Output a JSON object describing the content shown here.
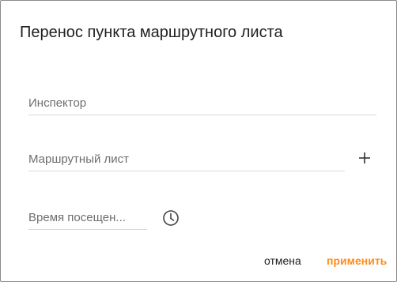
{
  "dialog": {
    "title": "Перенос пункта маршрутного листа",
    "fields": {
      "inspector_placeholder": "Инспектор",
      "route_sheet_placeholder": "Маршрутный лист",
      "visit_time_placeholder": "Время посещен..."
    },
    "icons": {
      "add": "plus-icon",
      "time": "clock-icon"
    },
    "buttons": {
      "cancel": "отмена",
      "apply": "применить"
    },
    "colors": {
      "accent": "#ff8c1a",
      "border": "#8a8a8a"
    }
  }
}
